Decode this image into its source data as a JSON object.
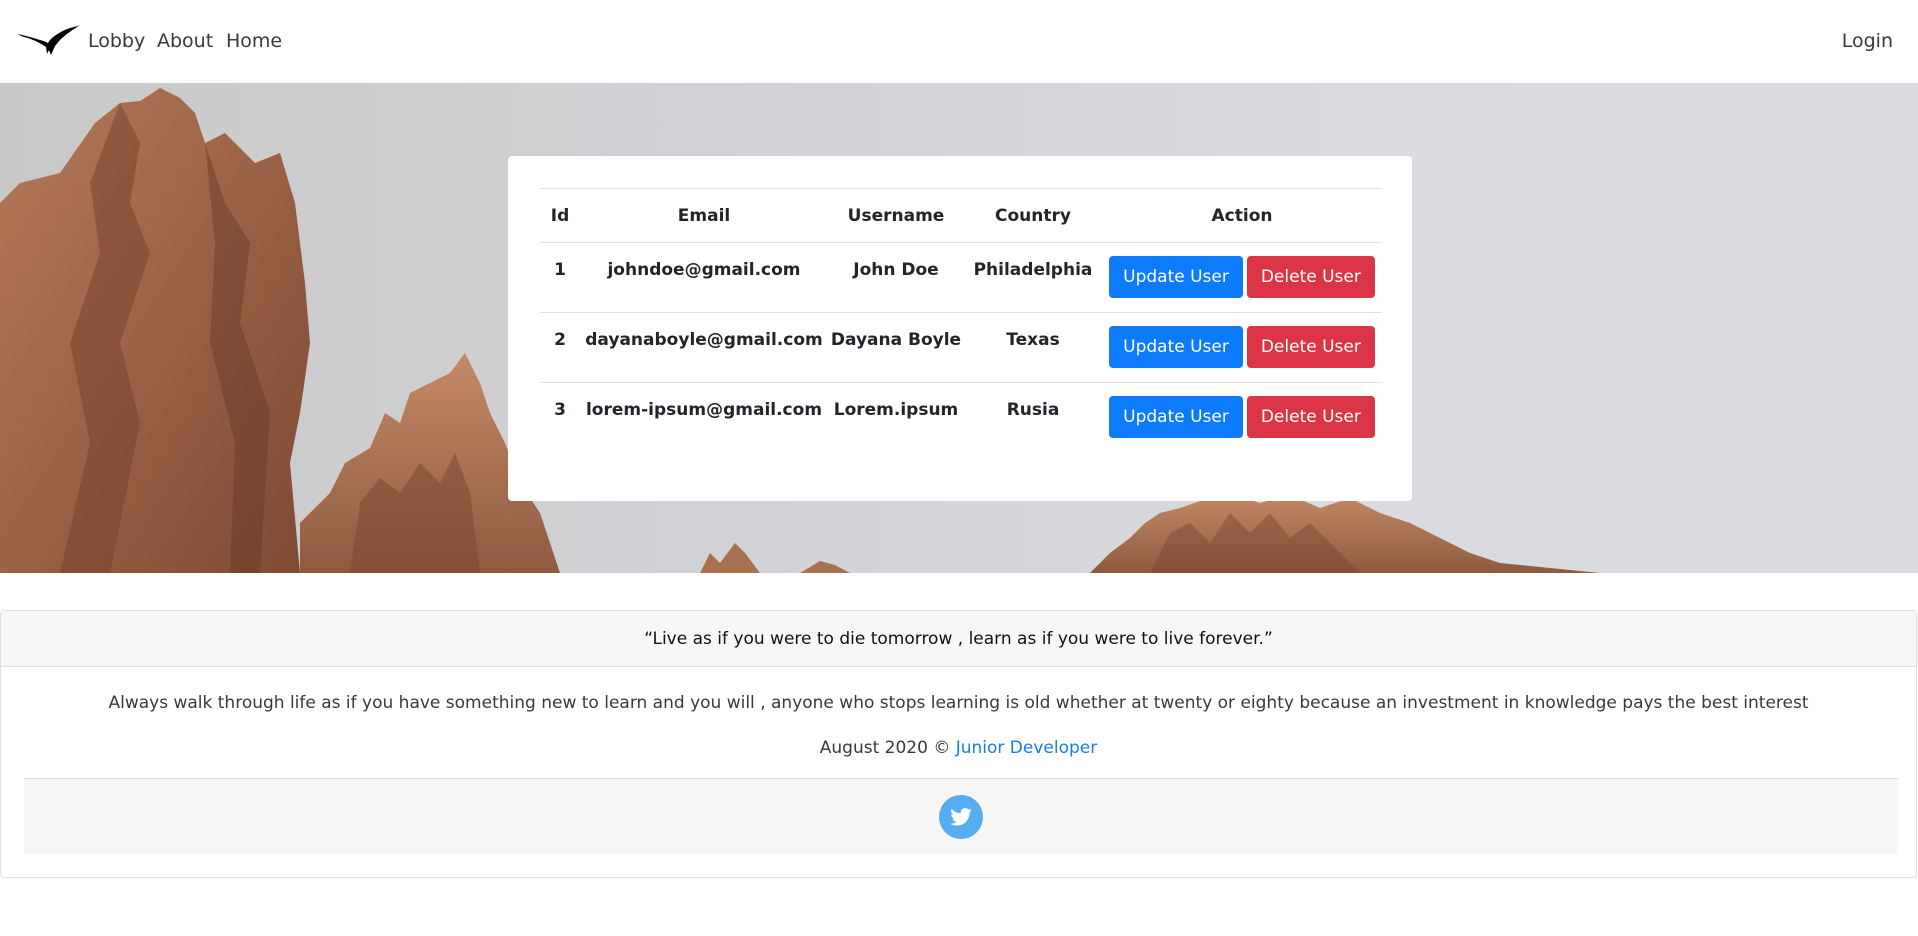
{
  "navbar": {
    "brand_icon": "eagle-logo-icon",
    "links": [
      "Lobby",
      "About",
      "Home"
    ],
    "login": "Login"
  },
  "table": {
    "headers": [
      "Id",
      "Email",
      "Username",
      "Country",
      "Action"
    ],
    "rows": [
      {
        "id": "1",
        "email": "johndoe@gmail.com",
        "username": "John Doe",
        "country": "Philadelphia"
      },
      {
        "id": "2",
        "email": "dayanaboyle@gmail.com",
        "username": "Dayana Boyle",
        "country": "Texas"
      },
      {
        "id": "3",
        "email": "lorem-ipsum@gmail.com",
        "username": "Lorem.ipsum",
        "country": "Rusia"
      }
    ],
    "update_label": "Update User",
    "delete_label": "Delete User"
  },
  "footer": {
    "quote": "“Live as if you were to die tomorrow , learn as if you were to live forever.”",
    "description": "Always walk through life as if you have something new to learn and you will , anyone who stops learning is old whether at twenty or eighty because an investment in knowledge pays the best interest",
    "credit_prefix": "August 2020 © ",
    "credit_link": "Junior Developer",
    "social_icon": "twitter-icon"
  },
  "colors": {
    "update_button": "#0d7bfb",
    "delete_button": "#dc3545",
    "link": "#1a7ee0",
    "twitter": "#55acee"
  }
}
